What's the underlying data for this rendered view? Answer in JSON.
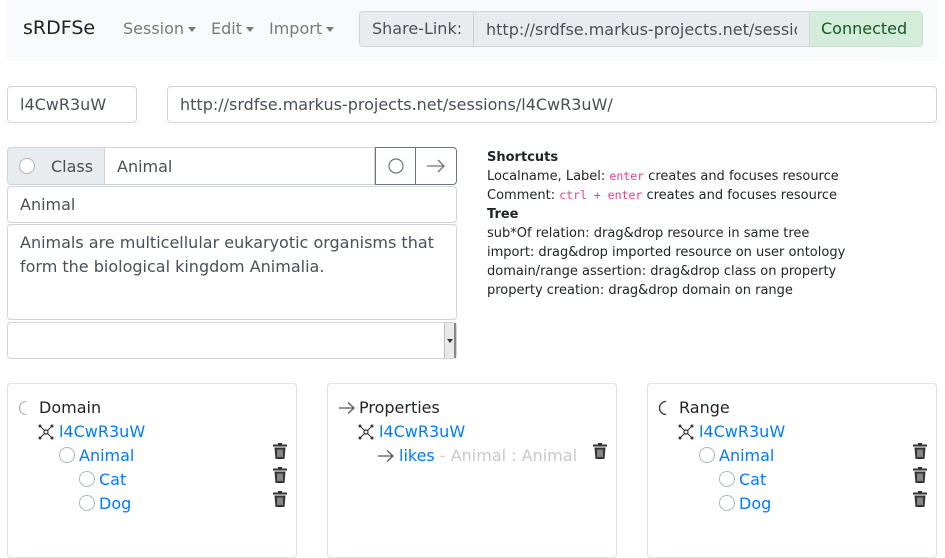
{
  "navbar": {
    "brand": "sRDFSe",
    "menu": [
      {
        "label": "Session"
      },
      {
        "label": "Edit"
      },
      {
        "label": "Import"
      }
    ],
    "share_label": "Share-Link:",
    "share_url": "http://srdfse.markus-projects.net/sessions/l4CwR3uW/",
    "status": "Connected"
  },
  "session": {
    "id": "l4CwR3uW",
    "url": "http://srdfse.markus-projects.net/sessions/l4CwR3uW/"
  },
  "editor": {
    "type_label": "Class",
    "localname": "Animal",
    "label": "Animal",
    "comment": "Animals are multicellular eukaryotic organisms that form the biological kingdom Animalia."
  },
  "shortcuts": {
    "title": "Shortcuts",
    "line1_prefix": "Localname, Label: ",
    "line1_key": "enter",
    "line1_suffix": " creates and focuses resource",
    "line2_prefix": "Comment: ",
    "line2_key": "ctrl + enter",
    "line2_suffix": " creates and focuses resource",
    "tree_title": "Tree",
    "tree_lines": [
      "sub*Of relation: drag&drop resource in same tree",
      "import: drag&drop imported resource on user ontology",
      "domain/range assertion: drag&drop class on property",
      "property creation: drag&drop domain on range"
    ]
  },
  "domain_panel": {
    "title": "Domain",
    "ontology": "l4CwR3uW",
    "root": "Animal",
    "children": [
      "Cat",
      "Dog"
    ]
  },
  "properties_panel": {
    "title": "Properties",
    "ontology": "l4CwR3uW",
    "property": "likes",
    "signature": " - Animal : Animal"
  },
  "range_panel": {
    "title": "Range",
    "ontology": "l4CwR3uW",
    "root": "Animal",
    "children": [
      "Cat",
      "Dog"
    ]
  },
  "colors": {
    "link": "#007bff",
    "connected_bg": "#d4edda",
    "connected_text": "#155724",
    "shortcut_key": "#e83e8c"
  }
}
